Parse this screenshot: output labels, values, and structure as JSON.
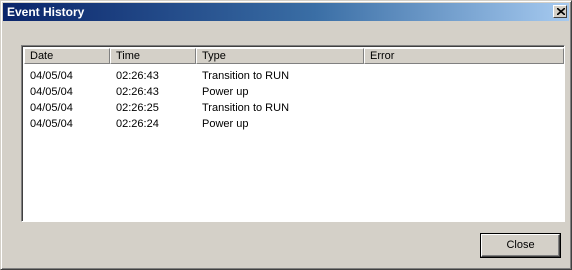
{
  "window": {
    "title": "Event History"
  },
  "icons": {
    "close": "close-icon"
  },
  "columns": [
    {
      "label": "Date"
    },
    {
      "label": "Time"
    },
    {
      "label": "Type"
    },
    {
      "label": "Error"
    }
  ],
  "events": [
    {
      "date": "04/05/04",
      "time": "02:26:43",
      "type": "Transition to RUN",
      "error": ""
    },
    {
      "date": "04/05/04",
      "time": "02:26:43",
      "type": "Power up",
      "error": ""
    },
    {
      "date": "04/05/04",
      "time": "02:26:25",
      "type": "Transition to RUN",
      "error": ""
    },
    {
      "date": "04/05/04",
      "time": "02:26:24",
      "type": "Power up",
      "error": ""
    }
  ],
  "buttons": {
    "close_label": "Close"
  },
  "colors": {
    "titlebar_start": "#0a246a",
    "titlebar_end": "#a6caf0",
    "dialog_face": "#d4d0c8"
  }
}
